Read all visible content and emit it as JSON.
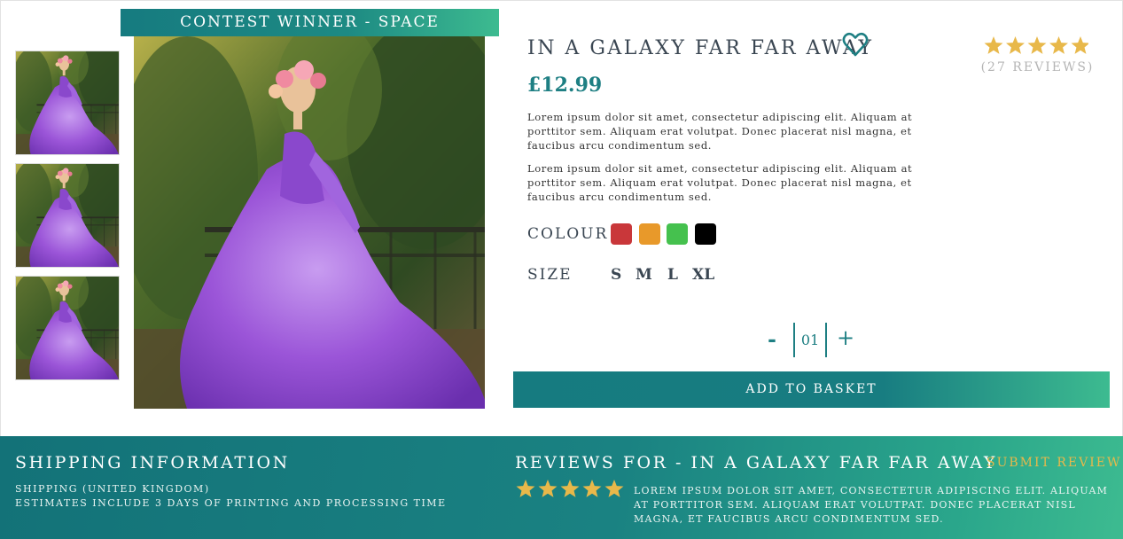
{
  "product": {
    "banner": "CONTEST WINNER - SPACE",
    "title": "IN A GALAXY FAR FAR AWAY",
    "price": "£12.99",
    "rating": 5,
    "reviews_count": "(27 REVIEWS)",
    "description": [
      "Lorem ipsum dolor sit amet, consectetur adipiscing elit. Aliquam at porttitor sem.  Aliquam erat volutpat. Donec placerat nisl magna, et faucibus arcu condimentum sed.",
      "Lorem ipsum dolor sit amet, consectetur adipiscing elit. Aliquam at porttitor sem.  Aliquam erat volutpat. Donec placerat nisl magna, et faucibus arcu condimentum sed."
    ],
    "colour_label": "COLOUR",
    "colours": [
      "#c9373a",
      "#e8992a",
      "#45c14e",
      "#000000"
    ],
    "size_label": "SIZE",
    "sizes": [
      "S",
      "M",
      "L",
      "XL"
    ],
    "quantity": {
      "minus": "-",
      "value": "01",
      "plus": "+"
    },
    "add_to_basket": "ADD TO BASKET",
    "icons": {
      "favorite": "heart-outline-icon",
      "rating": "star-icon"
    }
  },
  "footer": {
    "shipping_title": "SHIPPING INFORMATION",
    "shipping_lines": [
      "SHIPPING (UNITED KINGDOM)",
      "ESTIMATES INCLUDE 3 DAYS OF PRINTING AND PROCESSING TIME"
    ],
    "reviews_title": "REVIEWS FOR - IN A GALAXY FAR FAR AWAY",
    "submit_review": "SUBMIT REVIEW",
    "review_rating": 5,
    "review_text": "LOREM IPSUM DOLOR SIT AMET, CONSECTETUR ADIPISCING ELIT. ALIQUAM AT PORTTITOR SEM.  ALIQUAM ERAT VOLUTPAT. DONEC PLACERAT NISL MAGNA, ET FAUCIBUS ARCU CONDIMENTUM SED."
  },
  "colors": {
    "accent": "#1e7f83",
    "accent_light": "#3dbb90",
    "star": "#e8b84a",
    "muted": "#b5b5b5"
  }
}
